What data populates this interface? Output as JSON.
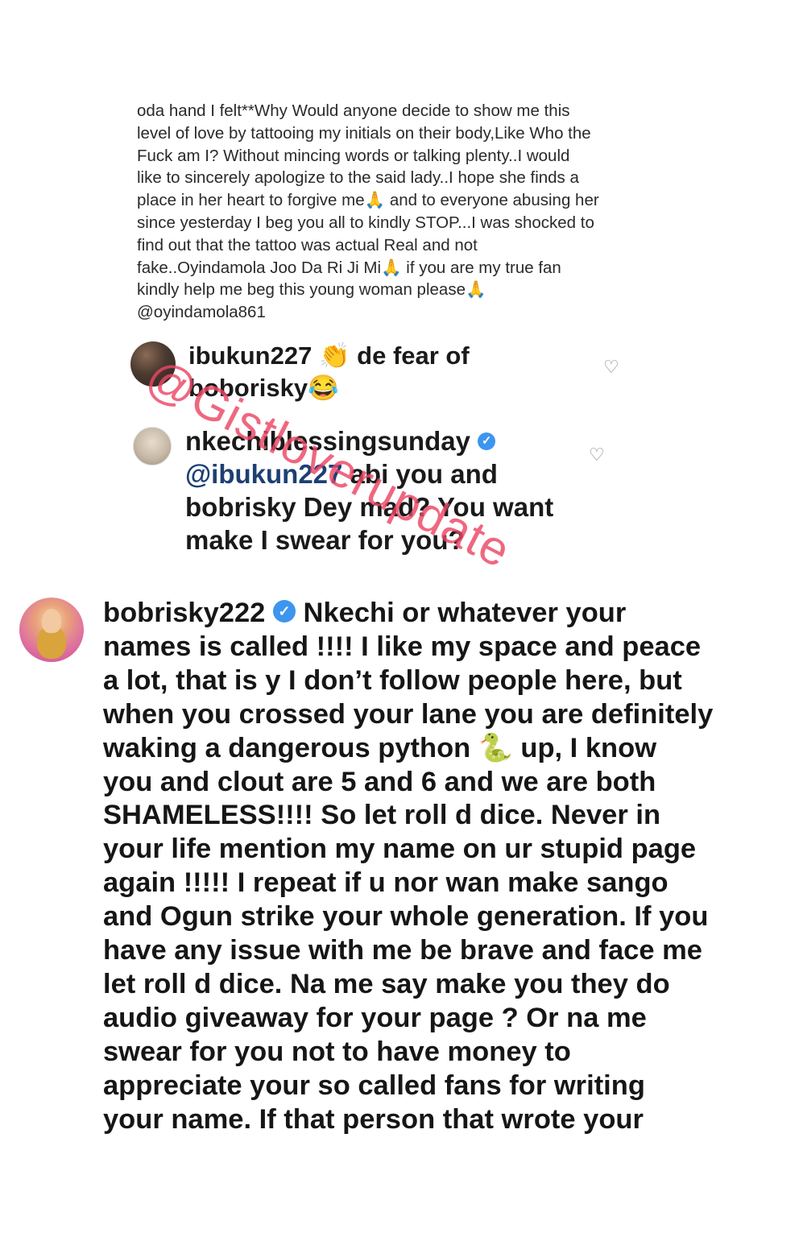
{
  "post": {
    "caption_text": "oda hand I felt**Why Would anyone decide to show me this\nlevel of love by tattooing my initials on their body,Like Who the\nFuck am I? Without mincing words or talking  plenty..I would\nlike to sincerely apologize to the said lady..I hope she finds a\nplace in her heart to forgive me🙏 and to everyone abusing her\nsince yesterday I beg you all to kindly STOP...I was shocked to\nfind out that the tattoo was actual Real and not\nfake..Oyindamola Joo Da Ri Ji Mi🙏 if you are my true fan\nkindly help me beg this young woman please🙏\n@oyindamola861"
  },
  "comments": [
    {
      "username": "ibukun227",
      "verified": false,
      "text": " 👏 de fear of boborisky😂",
      "avatar_icon": "user-avatar-icon",
      "like_icon": "heart-outline-icon"
    },
    {
      "username": "nkechiblessingsunday",
      "verified": true,
      "mention": "@ibukun227",
      "text": " abi you and bobrisky Dey mad? You want make I swear for you?",
      "avatar_icon": "user-avatar-icon",
      "like_icon": "heart-outline-icon"
    }
  ],
  "reply": {
    "username": "bobrisky222",
    "verified": true,
    "text_part1": " Nkechi or whatever your\nnames is called !!!! I like my space and peace\na lot, that is y I don’t follow people here, but\nwhen you crossed your lane you are definitely\nwaking a dangerous python ",
    "snake_emoji": "🐍",
    "text_part2": " up,  I know\nyou and clout are 5 and 6 and we are both\nSHAMELESS!!!! So let roll d dice.  Never in\nyour life mention my name on ur stupid page\nagain !!!!! I repeat if u nor wan make sango\nand Ogun strike your whole generation. If you\nhave any issue with me be brave and face me\nlet roll d dice.  Na me say make you they do\naudio giveaway for your page ? Or na me\nswear for you not to have money to\nappreciate your so called fans for writing\nyour name. If that person that wrote your"
  },
  "watermark": {
    "text": "@Gistloverupdate"
  },
  "colors": {
    "mention": "#1d3f73",
    "verified": "#3d95ef",
    "watermark": "#ec4664",
    "heart": "#8e8e8e"
  }
}
